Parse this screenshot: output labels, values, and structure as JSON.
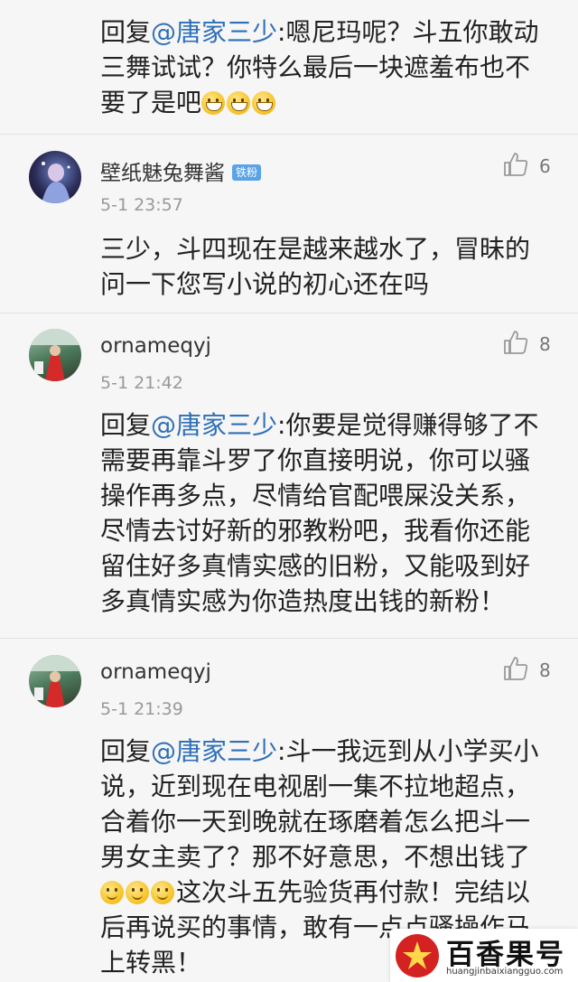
{
  "comments": [
    {
      "mention": "@唐家三少",
      "prefix": "回复",
      "lines_html_parts": {
        "l1_rest": ":嗯尼玛呢？斗五你敢动",
        "l2": "三舞试试？你特么最后一块遮羞布也不",
        "l3": "要了是吧"
      },
      "emoji": [
        "grinning-face",
        "grinning-face",
        "grinning-face"
      ]
    },
    {
      "username": "壁纸魅兔舞酱",
      "badge": "铁粉",
      "time": "5-1 23:57",
      "likes": "6",
      "l1": "三少，斗四现在是越来越水了，冒昧的",
      "l2": "问一下您写小说的初心还在吗"
    },
    {
      "username": "ornameqyj",
      "time": "5-1 21:42",
      "likes": "8",
      "prefix": "回复",
      "mention": "@唐家三少",
      "l1_rest": ":你要是觉得赚得够了不",
      "l2": "需要再靠斗罗了你直接明说，你可以骚",
      "l3": "操作再多点，尽情给官配喂屎没关系，",
      "l4": "尽情去讨好新的邪教粉吧，我看你还能",
      "l5": "留住好多真情实感的旧粉，又能吸到好",
      "l6": "多真情实感为你造热度出钱的新粉！"
    },
    {
      "username": "ornameqyj",
      "time": "5-1 21:39",
      "likes": "8",
      "prefix": "回复",
      "mention": "@唐家三少",
      "l1_rest": ":斗一我远到从小学买小",
      "l2": "说，近到现在电视剧一集不拉地超点，",
      "l3": "合着你一天到晚就在琢磨着怎么把斗一",
      "l4": "男女主卖了？那不好意思，不想出钱了",
      "l5_rest": "这次斗五先验货再付款！完结以",
      "l6": "后再说买的事情，敢有一点点骚操作马",
      "l7": "上转黑！",
      "emoji": [
        "smiling-face",
        "smiling-face",
        "smiling-face"
      ]
    }
  ],
  "watermark": {
    "title": "百香果号",
    "url": "huangjinbaixiangguo.com"
  },
  "colors": {
    "mention": "#2d6fb8",
    "badge": "#5aa3e6"
  }
}
